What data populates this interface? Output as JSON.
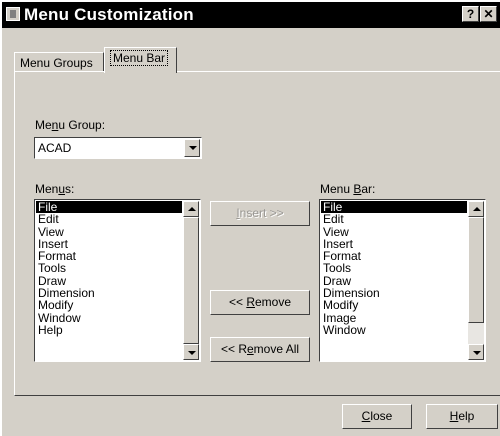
{
  "window": {
    "title": "Menu Customization",
    "help_button": "?",
    "close_button": "✕"
  },
  "tabs": [
    {
      "label": "Menu Groups",
      "active": false
    },
    {
      "label": "Menu Bar",
      "active": true
    }
  ],
  "menu_group": {
    "label_pre": "Me",
    "label_key": "n",
    "label_post": "u Group:",
    "value": "ACAD"
  },
  "menus": {
    "label_pre": "Men",
    "label_key": "u",
    "label_post": "s:",
    "items": [
      "File",
      "Edit",
      "View",
      "Insert",
      "Format",
      "Tools",
      "Draw",
      "Dimension",
      "Modify",
      "Window",
      "Help"
    ],
    "selected": "File"
  },
  "menu_bar": {
    "label_pre": "Menu ",
    "label_key": "B",
    "label_post": "ar:",
    "items": [
      "File",
      "Edit",
      "View",
      "Insert",
      "Format",
      "Tools",
      "Draw",
      "Dimension",
      "Modify",
      "Image",
      "Window"
    ],
    "selected": "File"
  },
  "buttons": {
    "insert": {
      "pre": "",
      "key": "I",
      "post": "nsert >>",
      "enabled": false
    },
    "remove": {
      "pre": "<< ",
      "key": "R",
      "post": "emove",
      "enabled": true
    },
    "remove_all": {
      "pre": "<< R",
      "key": "e",
      "post": "move All",
      "enabled": true
    },
    "close": {
      "pre": "",
      "key": "C",
      "post": "lose"
    },
    "help": {
      "pre": "",
      "key": "H",
      "post": "elp"
    }
  }
}
